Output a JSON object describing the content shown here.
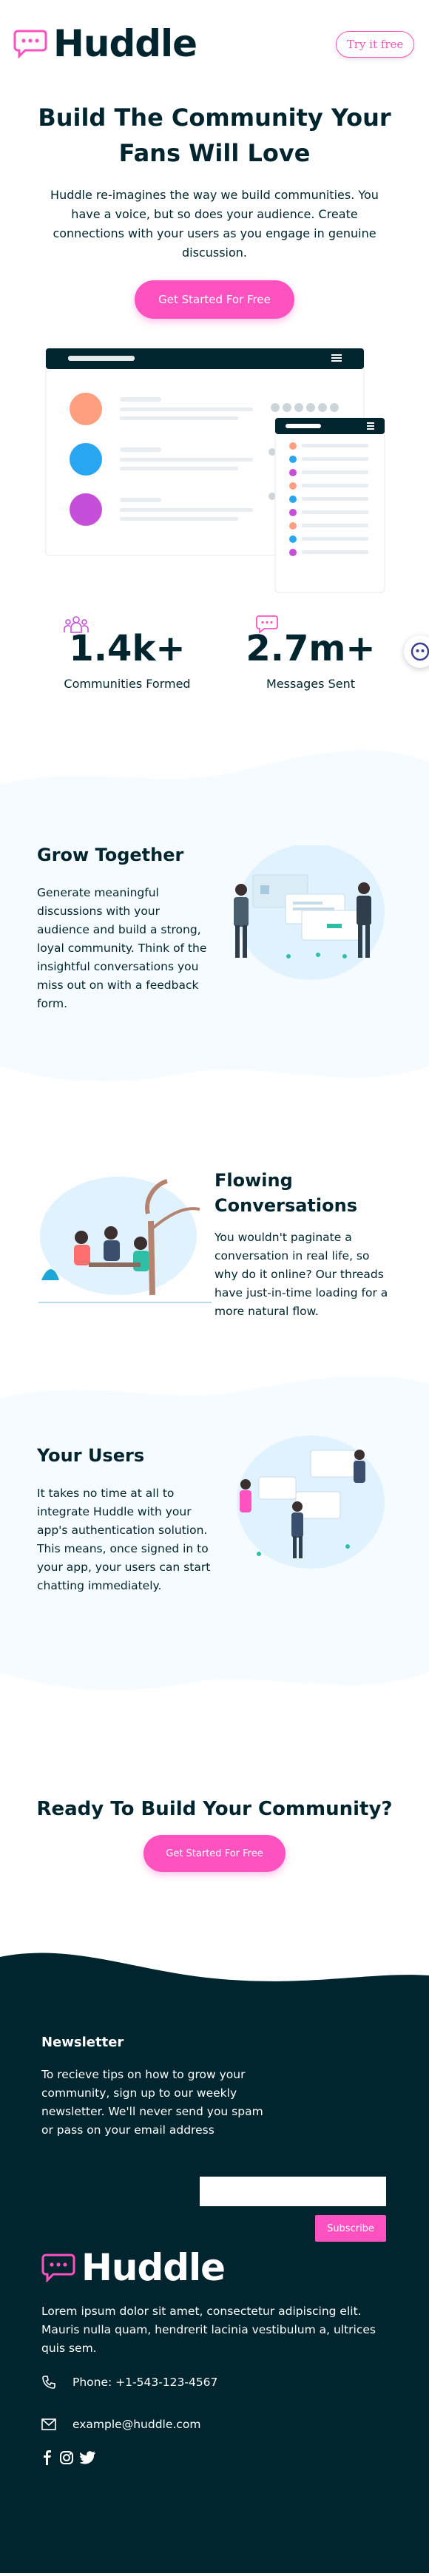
{
  "brand": {
    "name": "Huddle"
  },
  "header": {
    "try_label": "Try it free"
  },
  "hero": {
    "title_line1": "Build The Community Your",
    "title_line2": "Fans Will Love",
    "description": "Huddle re-imagines the way we build communities. You have a voice, but so does your audience. Create connections with your users as you engage in genuine discussion.",
    "cta_label": "Get Started For Free"
  },
  "stats": [
    {
      "value": "1.4k+",
      "label": "Communities Formed"
    },
    {
      "value": "2.7m+",
      "label": "Messages Sent"
    }
  ],
  "features": [
    {
      "title": "Grow Together",
      "text": "Generate meaningful discussions with your audience and build a strong, loyal community. Think of the insightful conversations you miss out on with a feedback form."
    },
    {
      "title_line1": "Flowing",
      "title_line2": "Conversations",
      "text": "You wouldn't paginate a conversation in real life, so why do it online? Our threads have just-in-time loading for a more natural flow."
    },
    {
      "title": "Your Users",
      "text": "It takes no time at all to integrate Huddle with your app's authentication solution. This means, once signed in to your app, your users can start chatting immediately."
    }
  ],
  "ready": {
    "title": "Ready To Build Your Community?",
    "cta_label": "Get Started For Free"
  },
  "footer": {
    "newsletter_title": "Newsletter",
    "newsletter_text": "To recieve tips on how to grow your community, sign up to our weekly newsletter. We'll never send you spam or pass on your email address",
    "email_value": "",
    "subscribe_label": "Subscribe",
    "about": "Lorem ipsum dolor sit amet, consectetur adipiscing elit. Mauris nulla quam, hendrerit lacinia vestibulum a, ultrices quis sem.",
    "phone": "Phone: +1-543-123-4567",
    "email": "example@huddle.com"
  },
  "colors": {
    "pink": "#ff52c1",
    "dark": "#00252e",
    "light": "#f5fbff"
  },
  "icons": [
    "chat-logo-icon",
    "communities-icon",
    "messages-icon",
    "phone-icon",
    "mail-icon",
    "facebook-icon",
    "instagram-icon",
    "twitter-icon",
    "bot-icon"
  ]
}
